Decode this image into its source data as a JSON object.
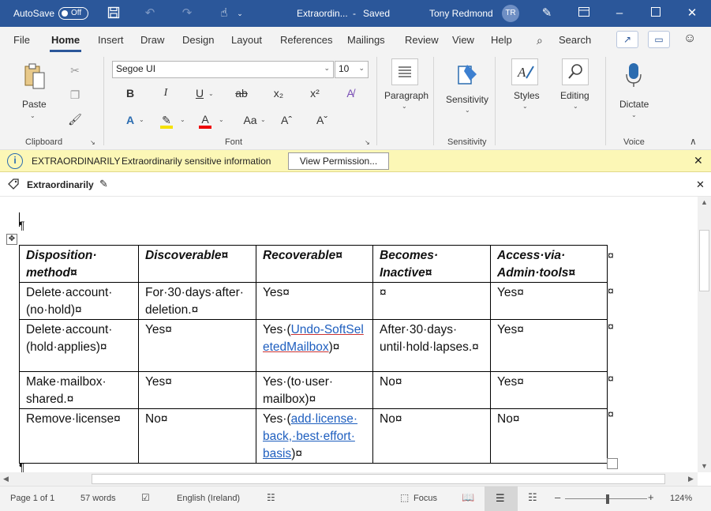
{
  "titlebar": {
    "autosave_label": "AutoSave",
    "autosave_state": "Off",
    "doc_title": "Extraordin...",
    "save_state": "Saved",
    "user_name": "Tony Redmond",
    "user_initials": "TR"
  },
  "tabs": [
    "File",
    "Home",
    "Insert",
    "Draw",
    "Design",
    "Layout",
    "References",
    "Mailings",
    "Review",
    "View",
    "Help"
  ],
  "search_label": "Search",
  "ribbon": {
    "paste_label": "Paste",
    "clipboard_group": "Clipboard",
    "font_name": "Segoe UI",
    "font_size": "10",
    "font_group": "Font",
    "paragraph_label": "Paragraph",
    "sensitivity_label": "Sensitivity",
    "sensitivity_group": "Sensitivity",
    "styles_label": "Styles",
    "editing_label": "Editing",
    "dictate_label": "Dictate",
    "voice_group": "Voice",
    "bold": "B",
    "italic": "I",
    "underline": "U",
    "strike": "ab",
    "subscript": "x₂",
    "superscript": "x²",
    "change_case": "Aa",
    "grow": "Aˆ",
    "shrink": "Aˇ"
  },
  "infobar": {
    "label_name": "EXTRAORDINARILY",
    "label_desc": "Extraordinarily sensitive information",
    "button": "View Permission..."
  },
  "labelbar": {
    "label": "Extraordinarily"
  },
  "document": {
    "header": [
      "Disposition· method¤",
      "Discoverable¤",
      "Recoverable¤",
      "Becomes· Inactive¤",
      "Access·via· Admin·tools¤"
    ],
    "rows": [
      {
        "c1": "Delete·account· (no·hold)¤",
        "c2": "For·30·days·after· deletion.¤",
        "c3": "Yes¤",
        "c3_link": "",
        "c3_after": "",
        "c4": "¤",
        "c5": "Yes¤"
      },
      {
        "c1": "Delete·account· (hold·applies)¤",
        "c2": "Yes¤",
        "c3": "Yes·(",
        "c3_link": "Undo-SoftSeletedMailbox",
        "c3_after": ")¤",
        "c4": "After·30·days· until·hold·lapses.¤",
        "c5": "Yes¤"
      },
      {
        "c1": "Make·mailbox· shared.¤",
        "c2": "Yes¤",
        "c3": "Yes·(to·user· mailbox)¤",
        "c3_link": "",
        "c3_after": "",
        "c4": "No¤",
        "c5": "Yes¤"
      },
      {
        "c1": "Remove·license¤",
        "c2": "No¤",
        "c3": "Yes·(",
        "c3_link": "add·license· back,·best·effort· basis",
        "c3_after": ")¤",
        "c4": "No¤",
        "c5": "No¤"
      }
    ],
    "pilcrow": "¶",
    "end_mark": "¤"
  },
  "status": {
    "page": "Page 1 of 1",
    "words": "57 words",
    "language": "English (Ireland)",
    "focus": "Focus",
    "zoom": "124%"
  },
  "colors": {
    "title_bar": "#2b579a",
    "info_bar": "#fcf7b6",
    "link": "#1f5fbf"
  }
}
